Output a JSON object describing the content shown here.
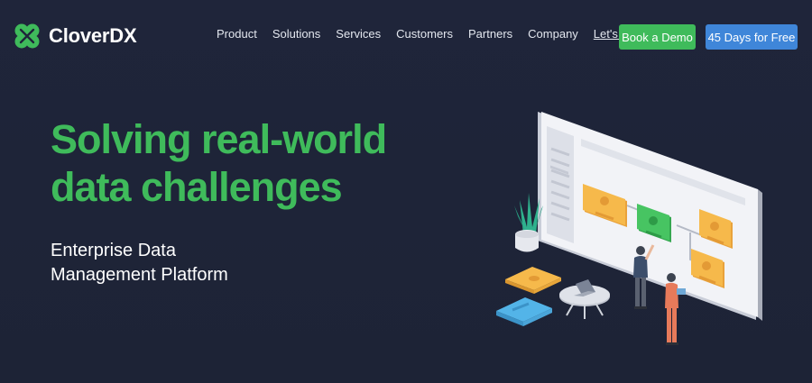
{
  "brand": {
    "name": "CloverDX",
    "logo_color": "#3fbb5b"
  },
  "nav": {
    "items": [
      "Product",
      "Solutions",
      "Services",
      "Customers",
      "Partners",
      "Company"
    ],
    "talk_label": "Let's Talk"
  },
  "buttons": {
    "demo_label": "Book a Demo",
    "free_label": "45 Days for Free",
    "demo_color": "#3fbb5b",
    "free_color": "#3f86d9"
  },
  "hero": {
    "title_line1": "Solving real-world",
    "title_line2": "data challenges",
    "subtitle_line1": "Enterprise Data",
    "subtitle_line2": "Management Platform",
    "accent_color": "#3fbb5b",
    "background_color": "#1e2438"
  },
  "illustration": {
    "icons": [
      "dashboard-board-illustration",
      "plant-icon",
      "person-icon",
      "laptop-icon"
    ]
  }
}
